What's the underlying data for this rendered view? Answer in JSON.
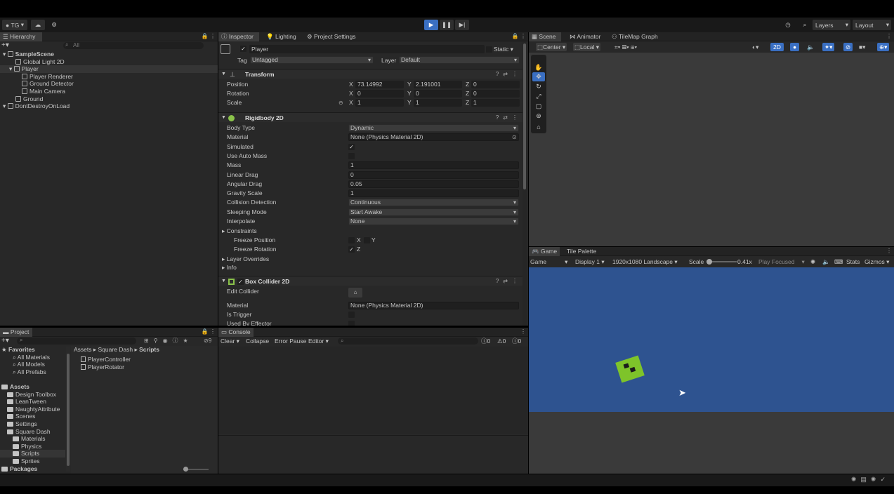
{
  "toolbar": {
    "account": "TG",
    "cloud": "cloud-icon",
    "settings": "gear-icon",
    "play": "play-icon",
    "pause": "pause-icon",
    "step": "step-icon",
    "history": "history-icon",
    "search": "search-icon",
    "layers": "Layers",
    "layout": "Layout"
  },
  "hierarchy": {
    "tab": "Hierarchy",
    "search_placeholder": "All",
    "items": [
      {
        "label": "SampleScene",
        "indent": 0,
        "bold": true
      },
      {
        "label": "Global Light 2D",
        "indent": 2
      },
      {
        "label": "Player",
        "indent": 1,
        "selected": true
      },
      {
        "label": "Player Renderer",
        "indent": 3
      },
      {
        "label": "Ground Detector",
        "indent": 3
      },
      {
        "label": "Main Camera",
        "indent": 3
      },
      {
        "label": "Ground",
        "indent": 2
      },
      {
        "label": "DontDestroyOnLoad",
        "indent": 0
      }
    ]
  },
  "inspector": {
    "tabs": [
      "Inspector",
      "Lighting",
      "Project Settings"
    ],
    "object_name": "Player",
    "static_label": "Static",
    "tag_label": "Tag",
    "tag_value": "Untagged",
    "layer_label": "Layer",
    "layer_value": "Default",
    "transform": {
      "title": "Transform",
      "position_label": "Position",
      "rotation_label": "Rotation",
      "scale_label": "Scale",
      "position": [
        "73.14992",
        "2.191001",
        "0"
      ],
      "rotation": [
        "0",
        "0",
        "0"
      ],
      "scale": [
        "1",
        "1",
        "1"
      ],
      "axes": [
        "X",
        "Y",
        "Z"
      ]
    },
    "rigidbody": {
      "title": "Rigidbody 2D",
      "rows": [
        {
          "label": "Body Type",
          "value": "Dynamic",
          "kind": "drop"
        },
        {
          "label": "Material",
          "value": "None (Physics Material 2D)",
          "kind": "obj"
        },
        {
          "label": "Simulated",
          "value": "✓",
          "kind": "check"
        },
        {
          "label": "Use Auto Mass",
          "value": "",
          "kind": "check"
        },
        {
          "label": "Mass",
          "value": "1",
          "kind": "field"
        },
        {
          "label": "Linear Drag",
          "value": "0",
          "kind": "field"
        },
        {
          "label": "Angular Drag",
          "value": "0.05",
          "kind": "field"
        },
        {
          "label": "Gravity Scale",
          "value": "1",
          "kind": "field"
        },
        {
          "label": "Collision Detection",
          "value": "Continuous",
          "kind": "drop"
        },
        {
          "label": "Sleeping Mode",
          "value": "Start Awake",
          "kind": "drop"
        },
        {
          "label": "Interpolate",
          "value": "None",
          "kind": "drop"
        }
      ],
      "constraints": "Constraints",
      "freeze_position": "Freeze Position",
      "freeze_rotation": "Freeze Rotation",
      "x": "X",
      "y": "Y",
      "z": "Z",
      "layer_overrides": "Layer Overrides",
      "info": "Info"
    },
    "boxcollider": {
      "title": "Box Collider 2D",
      "edit_collider": "Edit Collider",
      "material": "Material",
      "material_value": "None (Physics Material 2D)",
      "is_trigger": "Is Trigger",
      "used_by_effector": "Used By Effector"
    }
  },
  "scene": {
    "tabs": [
      "Scene",
      "Animator",
      "TileMap Graph"
    ],
    "pivot": "Center",
    "space": "Local",
    "mode_2d": "2D"
  },
  "game": {
    "tabs": [
      "Game",
      "Tile Palette"
    ],
    "view": "Game",
    "display": "Display 1",
    "resolution": "1920x1080 Landscape",
    "scale_label": "Scale",
    "scale_value": "0.41x",
    "play_mode": "Play Focused",
    "stats": "Stats",
    "gizmos": "Gizmos",
    "bg_color": "#2e5390",
    "player_color": "#7ec42a"
  },
  "project": {
    "tab": "Project",
    "favorites": "Favorites",
    "fav_items": [
      "All Materials",
      "All Models",
      "All Prefabs"
    ],
    "assets": "Assets",
    "asset_items": [
      {
        "label": "Design Toolbox",
        "indent": 1
      },
      {
        "label": "LeanTween",
        "indent": 1
      },
      {
        "label": "NaughtyAttribute",
        "indent": 1
      },
      {
        "label": "Scenes",
        "indent": 1
      },
      {
        "label": "Settings",
        "indent": 1
      },
      {
        "label": "Square Dash",
        "indent": 1
      },
      {
        "label": "Materials",
        "indent": 2
      },
      {
        "label": "Physics",
        "indent": 2
      },
      {
        "label": "Scripts",
        "indent": 2,
        "selected": true
      },
      {
        "label": "Sprites",
        "indent": 2
      }
    ],
    "packages": "Packages",
    "breadcrumb": [
      "Assets",
      "Square Dash",
      "Scripts"
    ],
    "files": [
      "PlayerController",
      "PlayerRotator"
    ],
    "hidden_count": "9"
  },
  "console": {
    "tab": "Console",
    "clear": "Clear",
    "collapse": "Collapse",
    "error_pause": "Error Pause",
    "editor": "Editor",
    "info_count": "0",
    "warn_count": "0",
    "error_count": "0"
  }
}
